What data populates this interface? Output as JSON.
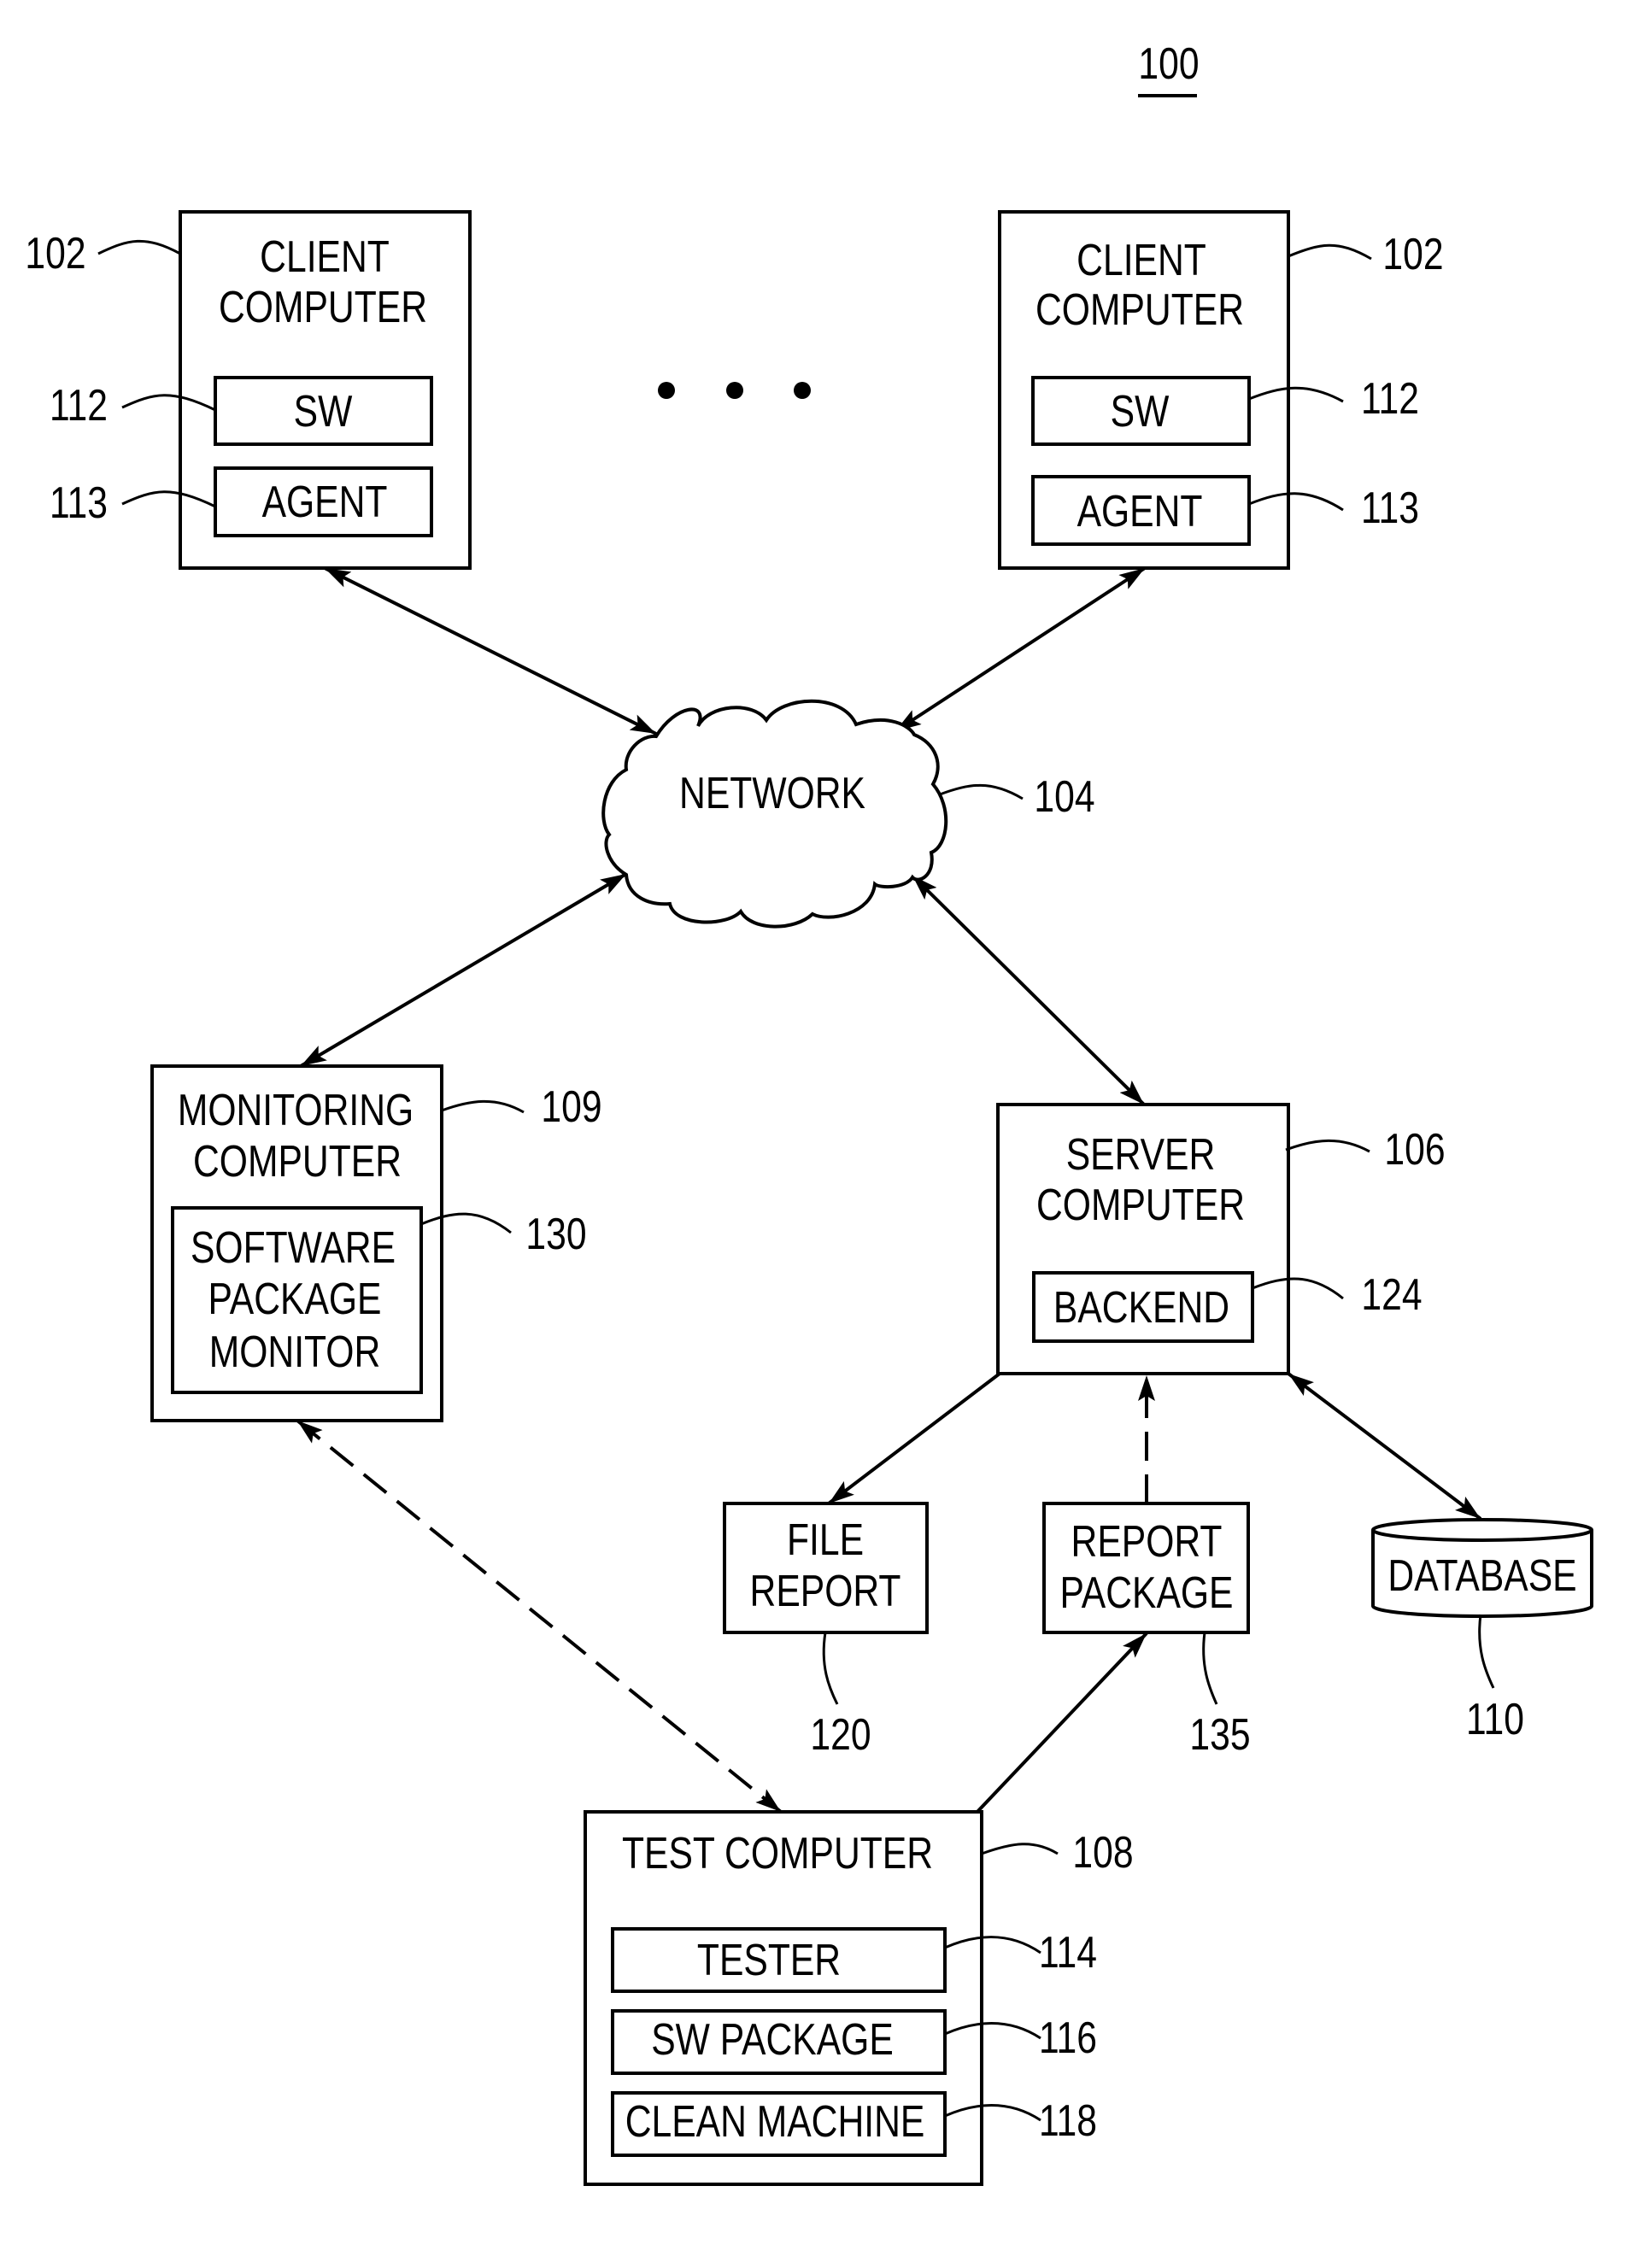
{
  "figure": {
    "number": "100",
    "ellipsis": "..."
  },
  "nodes": {
    "client_left": {
      "title_lines": [
        "CLIENT",
        "COMPUTER"
      ],
      "ref": "102",
      "components": [
        {
          "label": "SW",
          "ref": "112"
        },
        {
          "label": "AGENT",
          "ref": "113"
        }
      ]
    },
    "client_right": {
      "title_lines": [
        "CLIENT",
        "COMPUTER"
      ],
      "ref": "102",
      "components": [
        {
          "label": "SW",
          "ref": "112"
        },
        {
          "label": "AGENT",
          "ref": "113"
        }
      ]
    },
    "network": {
      "title": "NETWORK",
      "ref": "104"
    },
    "monitoring": {
      "title_lines": [
        "MONITORING",
        "COMPUTER"
      ],
      "ref": "109",
      "component": {
        "label_lines": [
          "SOFTWARE",
          "PACKAGE",
          "MONITOR"
        ],
        "ref": "130"
      }
    },
    "server": {
      "title_lines": [
        "SERVER",
        "COMPUTER"
      ],
      "ref": "106",
      "components": [
        {
          "label": "BACKEND",
          "ref": "124"
        }
      ]
    },
    "file_report": {
      "label_lines": [
        "FILE",
        "REPORT"
      ],
      "ref": "120"
    },
    "report_package": {
      "label_lines": [
        "REPORT",
        "PACKAGE"
      ],
      "ref": "135"
    },
    "database": {
      "label": "DATABASE",
      "ref": "110"
    },
    "test": {
      "title": "TEST COMPUTER",
      "ref": "108",
      "components": [
        {
          "label": "TESTER",
          "ref": "114"
        },
        {
          "label": "SW PACKAGE",
          "ref": "116"
        },
        {
          "label": "CLEAN MACHINE",
          "ref": "118"
        }
      ]
    }
  },
  "connections": [
    {
      "from": "client_left",
      "to": "network",
      "style": "solid",
      "direction": "bidirectional"
    },
    {
      "from": "client_right",
      "to": "network",
      "style": "solid",
      "direction": "bidirectional"
    },
    {
      "from": "monitoring",
      "to": "network",
      "style": "solid",
      "direction": "bidirectional"
    },
    {
      "from": "server",
      "to": "network",
      "style": "solid",
      "direction": "bidirectional"
    },
    {
      "from": "server",
      "to": "file_report",
      "style": "solid",
      "direction": "forward"
    },
    {
      "from": "report_package",
      "to": "server",
      "style": "dashed",
      "direction": "forward"
    },
    {
      "from": "server",
      "to": "database",
      "style": "solid",
      "direction": "bidirectional"
    },
    {
      "from": "test",
      "to": "report_package",
      "style": "solid",
      "direction": "forward"
    },
    {
      "from": "monitoring",
      "to": "test",
      "style": "dashed",
      "direction": "bidirectional"
    }
  ]
}
